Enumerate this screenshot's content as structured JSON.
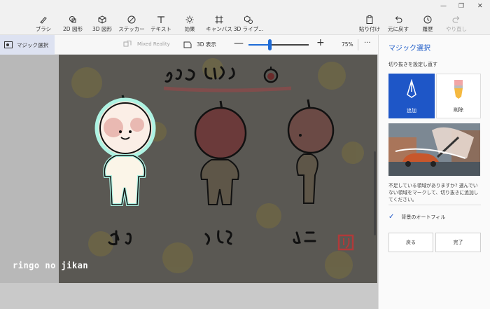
{
  "toolbar": {
    "tools": [
      {
        "label": "ブラシ",
        "icon": "brush-icon"
      },
      {
        "label": "2D 図形",
        "icon": "2d-shapes-icon"
      },
      {
        "label": "3D 図形",
        "icon": "3d-shapes-icon"
      },
      {
        "label": "ステッカー",
        "icon": "sticker-icon"
      },
      {
        "label": "テキスト",
        "icon": "text-icon"
      },
      {
        "label": "効果",
        "icon": "effects-icon"
      },
      {
        "label": "キャンバス",
        "icon": "canvas-icon"
      },
      {
        "label": "3D ライブ...",
        "icon": "3d-library-icon"
      }
    ],
    "actions": [
      {
        "label": "貼り付け",
        "icon": "paste-icon"
      },
      {
        "label": "元に戻す",
        "icon": "undo-icon"
      },
      {
        "label": "履歴",
        "icon": "history-icon"
      },
      {
        "label": "やり直し",
        "icon": "redo-icon"
      }
    ]
  },
  "window_controls": {
    "minimize": "—",
    "maximize": "❐",
    "close": "✕"
  },
  "subbar": {
    "magic_select": "マジック選択",
    "mixed_reality": "Mixed Reality",
    "view_3d": "3D 表示",
    "zoom_minus": "—",
    "zoom_plus": "+",
    "zoom_percent": "75%",
    "zoom_value": 0.35,
    "more": "···"
  },
  "canvas": {
    "watermark": "ringo no jikan"
  },
  "panel": {
    "title": "マジック選択",
    "subtitle": "切り抜きを設定し直す",
    "add_label": "追加",
    "delete_label": "削除",
    "help_text": "不足している領域がありますか? 選んでいない領域をマークして、切り抜きに追加してください。",
    "autofill_label": "背景のオートフィル",
    "autofill_checked": true,
    "back_label": "戻る",
    "done_label": "完了"
  },
  "colors": {
    "accent": "#1e56c7",
    "title": "#1f5cc8"
  }
}
